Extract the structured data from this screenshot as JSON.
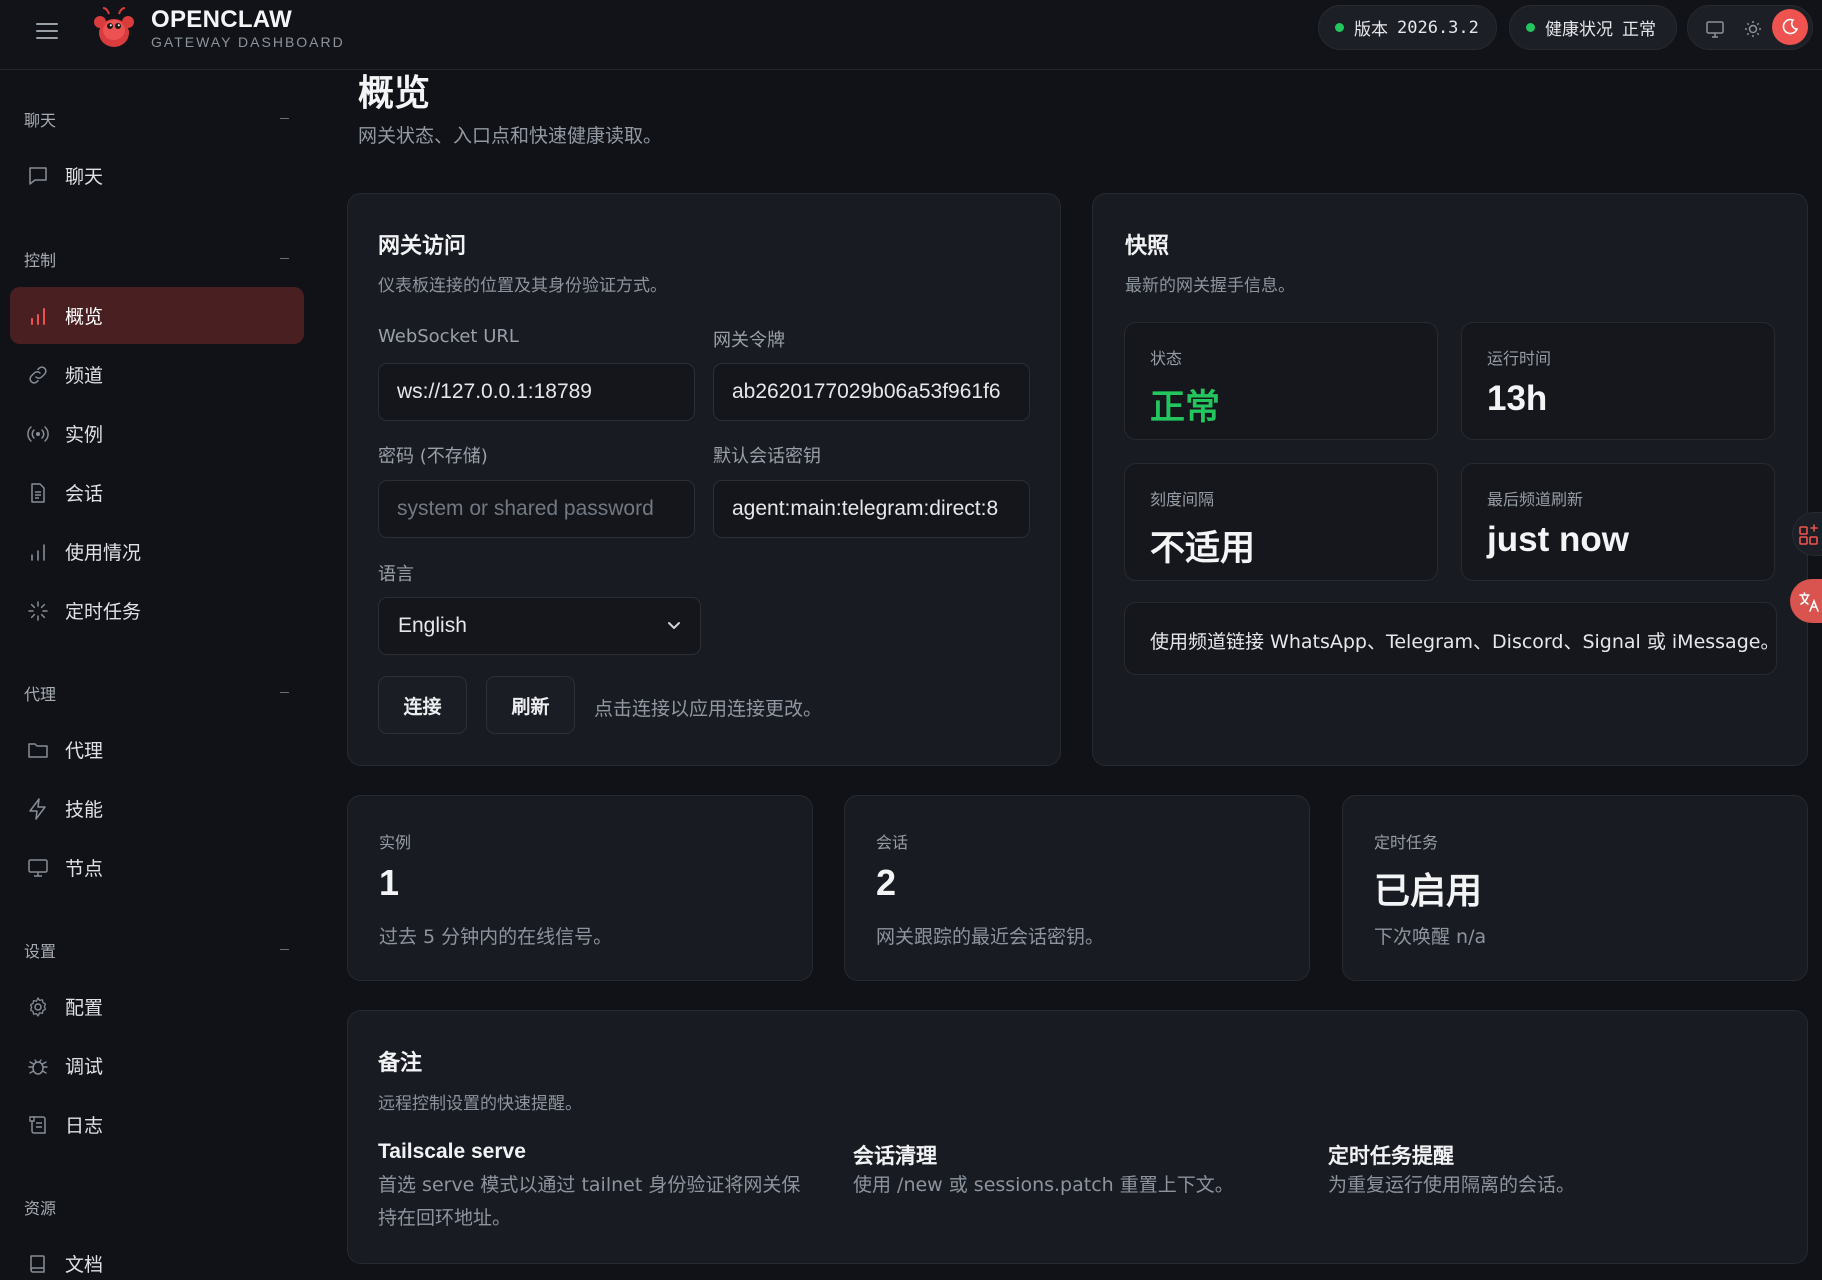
{
  "header": {
    "brand_name": "OPENCLAW",
    "brand_sub": "GATEWAY DASHBOARD",
    "version_label": "版本",
    "version_value": "2026.3.2",
    "health_label": "健康状况",
    "health_value": "正常",
    "status_color": "#22c55e",
    "accent_color": "#ef5350"
  },
  "sidebar": {
    "sections": [
      {
        "title": "聊天",
        "items": [
          {
            "label": "聊天",
            "icon": "chat-bubble-icon"
          }
        ]
      },
      {
        "title": "控制",
        "items": [
          {
            "label": "概览",
            "icon": "bar-chart-icon",
            "active": true
          },
          {
            "label": "频道",
            "icon": "link-icon"
          },
          {
            "label": "实例",
            "icon": "broadcast-icon"
          },
          {
            "label": "会话",
            "icon": "document-icon"
          },
          {
            "label": "使用情况",
            "icon": "bar-chart-icon"
          },
          {
            "label": "定时任务",
            "icon": "spinner-icon"
          }
        ]
      },
      {
        "title": "代理",
        "items": [
          {
            "label": "代理",
            "icon": "folder-icon"
          },
          {
            "label": "技能",
            "icon": "lightning-icon"
          },
          {
            "label": "节点",
            "icon": "monitor-icon"
          }
        ]
      },
      {
        "title": "设置",
        "items": [
          {
            "label": "配置",
            "icon": "gear-icon"
          },
          {
            "label": "调试",
            "icon": "bug-icon"
          },
          {
            "label": "日志",
            "icon": "log-icon"
          }
        ]
      },
      {
        "title": "资源",
        "items": [
          {
            "label": "文档",
            "icon": "book-icon"
          }
        ]
      }
    ]
  },
  "page": {
    "title": "概览",
    "subtitle": "网关状态、入口点和快速健康读取。"
  },
  "access": {
    "title": "网关访问",
    "subtitle": "仪表板连接的位置及其身份验证方式。",
    "ws_label": "WebSocket URL",
    "ws_value": "ws://127.0.0.1:18789",
    "token_label": "网关令牌",
    "token_value": "ab2620177029b06a53f961f6",
    "password_label": "密码 (不存储)",
    "password_placeholder": "system or shared password",
    "session_label": "默认会话密钥",
    "session_value": "agent:main:telegram:direct:8",
    "language_label": "语言",
    "language_value": "English",
    "connect_label": "连接",
    "refresh_label": "刷新",
    "hint": "点击连接以应用连接更改。"
  },
  "snapshot": {
    "title": "快照",
    "subtitle": "最新的网关握手信息。",
    "stats": [
      {
        "key": "状态",
        "value": "正常"
      },
      {
        "key": "运行时间",
        "value": "13h"
      },
      {
        "key": "刻度间隔",
        "value": "不适用"
      },
      {
        "key": "最后频道刷新",
        "value": "just now"
      }
    ],
    "notice": "使用频道链接 WhatsApp、Telegram、Discord、Signal 或 iMessage。"
  },
  "metrics": [
    {
      "key": "实例",
      "value": "1",
      "desc": "过去 5 分钟内的在线信号。"
    },
    {
      "key": "会话",
      "value": "2",
      "desc": "网关跟踪的最近会话密钥。"
    },
    {
      "key": "定时任务",
      "value": "已启用",
      "desc": "下次唤醒 n/a"
    }
  ],
  "notes": {
    "title": "备注",
    "subtitle": "远程控制设置的快速提醒。",
    "items": [
      {
        "title": "Tailscale serve",
        "lines": [
          "首选 serve 模式以通过 tailnet 身份验证将网关保",
          "持在回环地址。"
        ]
      },
      {
        "title": "会话清理",
        "lines": [
          "使用 /new 或 sessions.patch 重置上下文。"
        ]
      },
      {
        "title": "定时任务提醒",
        "lines": [
          "为重复运行使用隔离的会话。"
        ]
      }
    ]
  }
}
